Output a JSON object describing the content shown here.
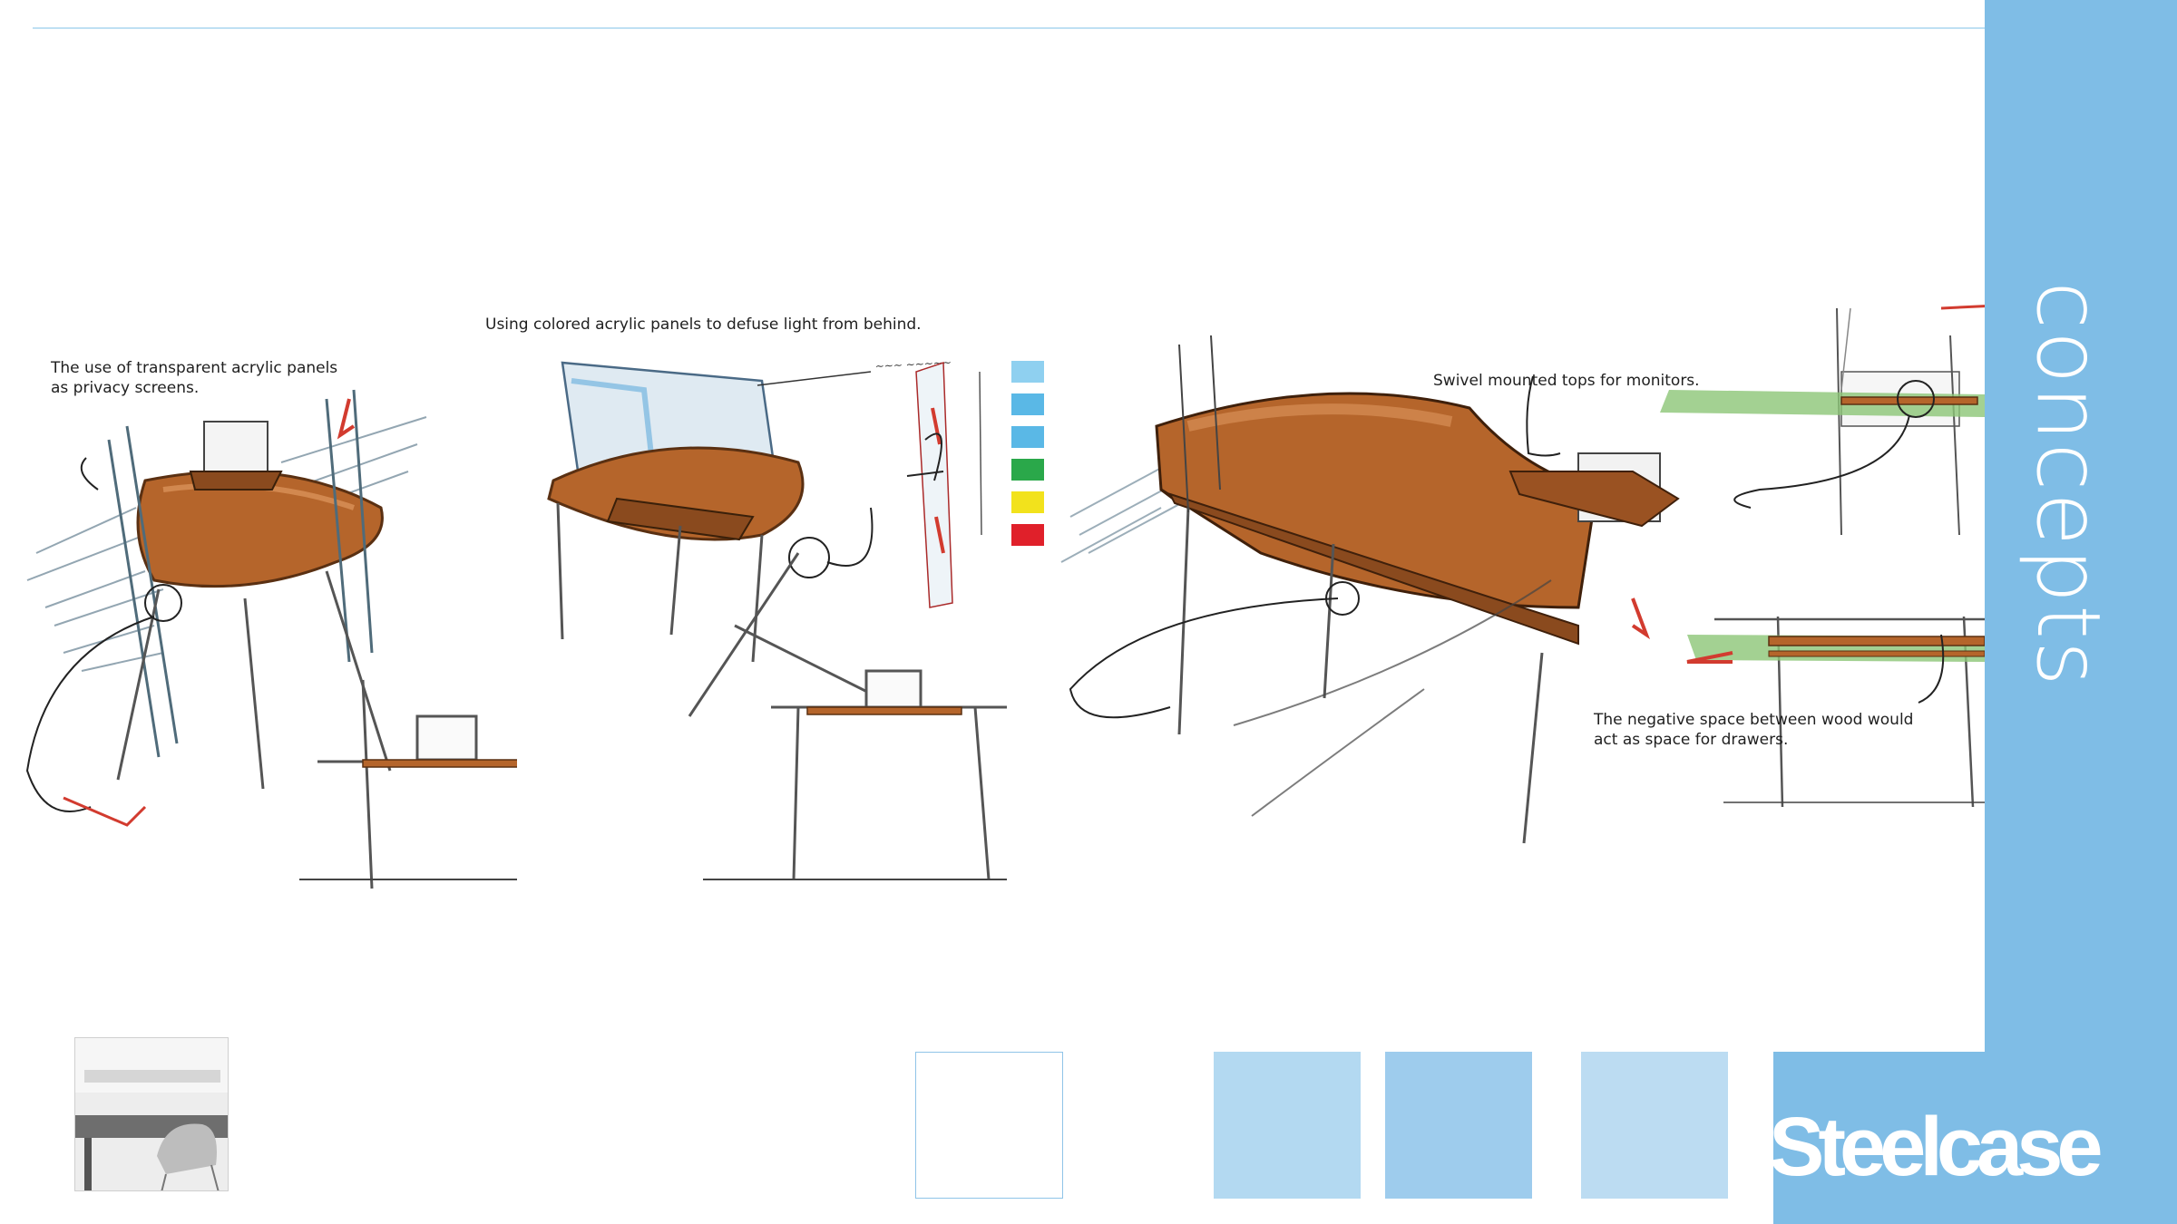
{
  "annotations": {
    "acrylic_privacy": "The use of transparent acrylic panels\nas privacy screens.",
    "colored_acrylic": "Using colored acrylic panels to defuse light from behind.",
    "swivel_tops": "Swivel mounted tops for monitors.",
    "negative_space": "The negative space between wood would\nact as space for drawers."
  },
  "sidebar": {
    "title": "concepts"
  },
  "brand": {
    "logo": "Steelcase"
  },
  "colors": {
    "band": "#7fbde6",
    "swatch_1": "#b3d9f1",
    "swatch_2": "#9ecced",
    "swatch_3": "#bcdcf2",
    "wood": "#b5652b",
    "acrylic_blue": "#5ab8e6",
    "acrylic_green": "#2aa84a",
    "acrylic_yellow": "#f2e21c",
    "acrylic_red": "#e0202a"
  },
  "palette_strip": [
    "light-blue",
    "blue",
    "blue",
    "green",
    "yellow",
    "red"
  ]
}
